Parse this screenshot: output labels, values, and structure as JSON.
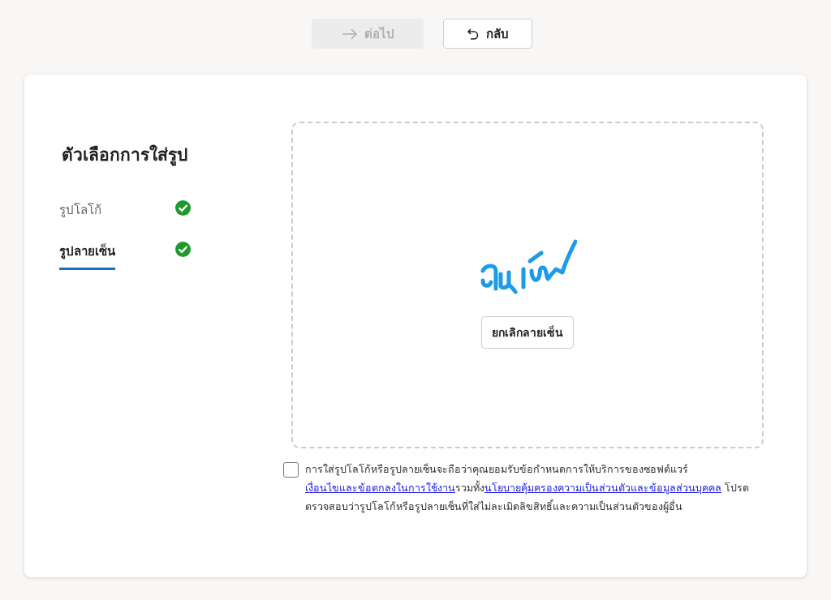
{
  "toolbar": {
    "buttons": [
      {
        "kind": "next",
        "label": "ต่อไป",
        "disabled": true
      },
      {
        "kind": "back",
        "label": "กลับ",
        "disabled": false
      }
    ]
  },
  "sidebar": {
    "title": "ตัวเลือกการใส่รูป",
    "items": [
      {
        "label": "รูปโลโก้",
        "selected": false,
        "done": true
      },
      {
        "label": "รูปลายเซ็น",
        "selected": true,
        "done": true
      }
    ]
  },
  "dropzone": {
    "has_signature": true,
    "button": "ยกเลิกลายเซ็น"
  },
  "consent": {
    "checked": false,
    "parts": [
      {
        "kind": "text",
        "text": "การใส่รูปโลโก้หรือรูปลายเซ็นจะถือว่าคุณยอมรับข้อกำหนดการให้บริการของซอฟต์แวร์"
      },
      {
        "kind": "link",
        "text": "เงื่อนไขและข้อตกลงในการใช้งาน"
      },
      {
        "kind": "text",
        "text": "รวมทั้ง"
      },
      {
        "kind": "link",
        "text": "นโยบายคุ้มครองความเป็นส่วนตัวและข้อมูลส่วนบุคคล"
      },
      {
        "kind": "text",
        "text": " โปรดตรวจสอบว่ารูปโลโก้หรือรูปลายเซ็นที่ใส่ไม่ละเมิดลิขสิทธิ์และความเป็นส่วนตัวของผู้อื่น"
      }
    ]
  }
}
